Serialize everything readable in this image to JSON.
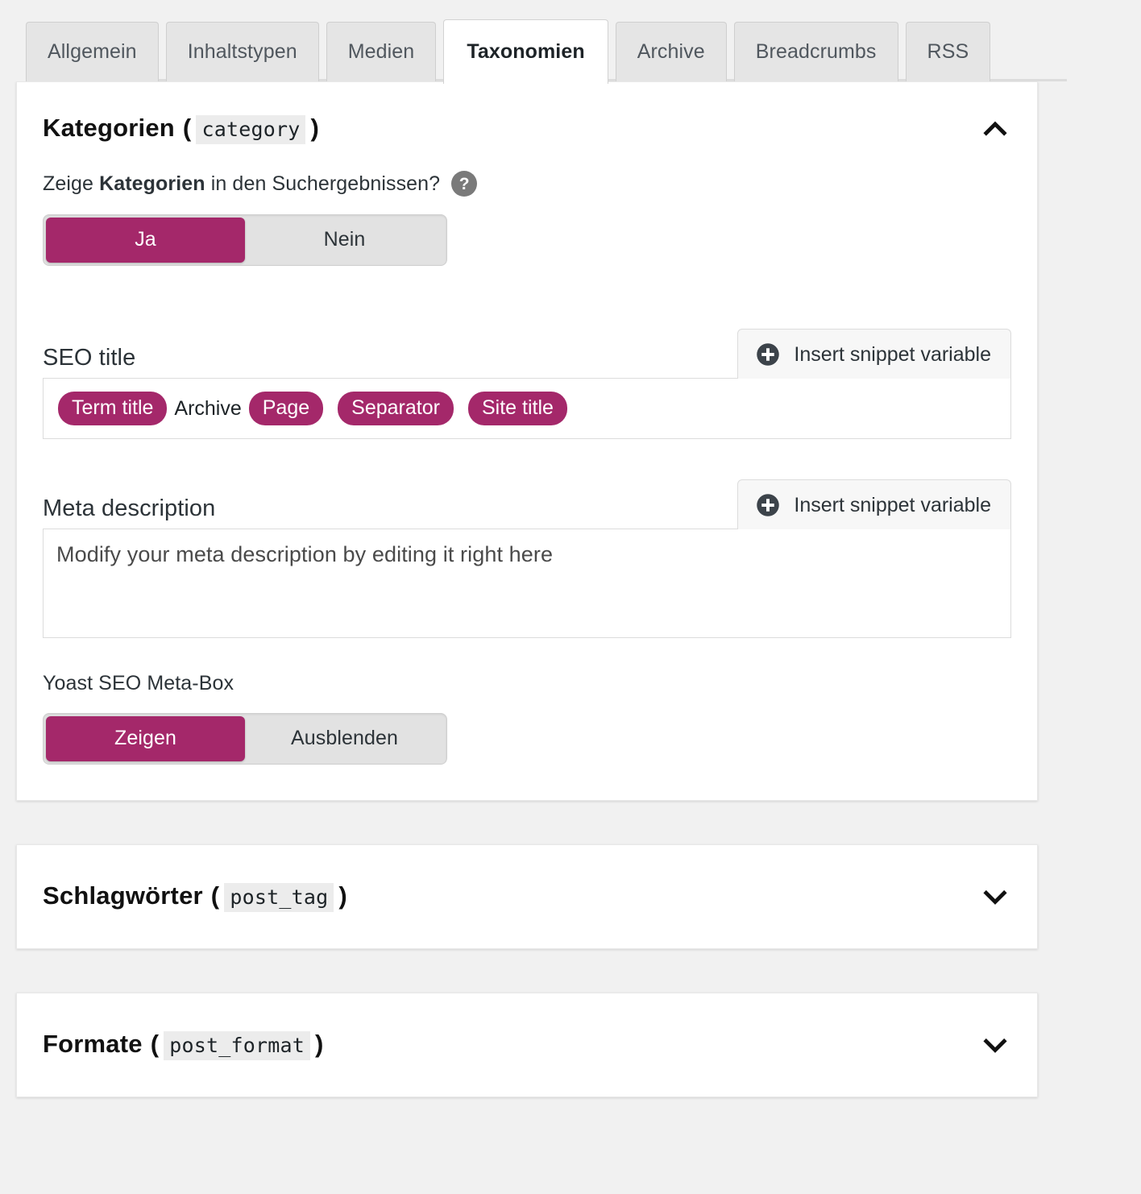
{
  "colors": {
    "accent": "#a4286a",
    "page_bg": "#f1f1f1",
    "card_bg": "#ffffff",
    "tab_inactive_bg": "#e5e5e5",
    "help_icon_bg": "#7a7a7a"
  },
  "tabs": [
    {
      "label": "Allgemein",
      "active": false
    },
    {
      "label": "Inhaltstypen",
      "active": false
    },
    {
      "label": "Medien",
      "active": false
    },
    {
      "label": "Taxonomien",
      "active": true
    },
    {
      "label": "Archive",
      "active": false
    },
    {
      "label": "Breadcrumbs",
      "active": false
    },
    {
      "label": "RSS",
      "active": false
    }
  ],
  "sections": [
    {
      "title": "Kategorien",
      "slug": "category",
      "paren_open": "(",
      "paren_close": ")",
      "expanded": true,
      "toggle_icon": "chevron-up-icon"
    },
    {
      "title": "Schlagwörter",
      "slug": "post_tag",
      "paren_open": "(",
      "paren_close": ")",
      "expanded": false,
      "toggle_icon": "chevron-down-icon"
    },
    {
      "title": "Formate",
      "slug": "post_format",
      "paren_open": "(",
      "paren_close": ")",
      "expanded": false,
      "toggle_icon": "chevron-down-icon"
    }
  ],
  "category_panel": {
    "search_visibility": {
      "label_prefix": "Zeige ",
      "label_bold": "Kategorien",
      "label_suffix": " in den Suchergebnissen?",
      "help_glyph": "?",
      "options": [
        {
          "label": "Ja",
          "selected": true
        },
        {
          "label": "Nein",
          "selected": false
        }
      ]
    },
    "seo_title": {
      "label": "SEO title",
      "insert_button_label": "Insert snippet variable",
      "tokens": [
        {
          "text": "Term title",
          "type": "variable"
        },
        {
          "text": "Archive",
          "type": "text"
        },
        {
          "text": "Page",
          "type": "variable"
        },
        {
          "text": "Separator",
          "type": "variable"
        },
        {
          "text": "Site title",
          "type": "variable"
        }
      ]
    },
    "meta_description": {
      "label": "Meta description",
      "insert_button_label": "Insert snippet variable",
      "value": "Modify your meta description by editing it right here"
    },
    "metabox": {
      "label": "Yoast SEO Meta-Box",
      "options": [
        {
          "label": "Zeigen",
          "selected": true
        },
        {
          "label": "Ausblenden",
          "selected": false
        }
      ]
    }
  }
}
